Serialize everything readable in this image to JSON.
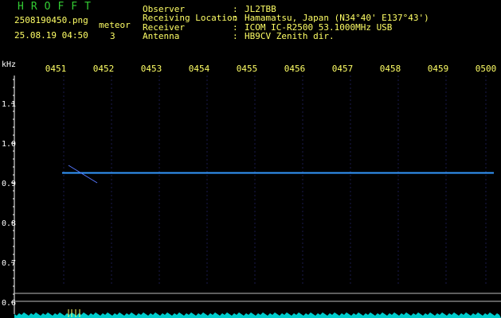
{
  "header": {
    "brand": "HROFFT",
    "filename": "2508190450.png",
    "datetime": "25.08.19 04:50",
    "meteor_label": "meteor",
    "meteor_count": "3",
    "info": [
      {
        "key": "Observer",
        "value": "JL2TBB"
      },
      {
        "key": "Receiving Location",
        "value": "Hamamatsu, Japan (N34°40' E137°43')"
      },
      {
        "key": "Receiver",
        "value": "ICOM IC-R2500 53.1000MHz USB"
      },
      {
        "key": "Antenna",
        "value": "HB9CV Zenith dir."
      }
    ]
  },
  "chart_data": {
    "type": "line",
    "ylabel": "kHz",
    "x_ticks": [
      "0451",
      "0452",
      "0453",
      "0454",
      "0455",
      "0456",
      "0457",
      "0458",
      "0459",
      "0500"
    ],
    "y_ticks": [
      "1.1",
      "1.0",
      "0.9",
      "0.8",
      "0.7",
      "0.6"
    ],
    "ylim": [
      0.6,
      1.15
    ],
    "series": [
      {
        "values": [
          0.925,
          0.925,
          0.925,
          0.925,
          0.925,
          0.925,
          0.925,
          0.925,
          0.925,
          0.925
        ]
      }
    ],
    "colors": {
      "background": "#000000",
      "carrier": "#3399ff",
      "noise": "#00cccc",
      "text": "#ffff66",
      "axis": "#ffffff"
    }
  }
}
